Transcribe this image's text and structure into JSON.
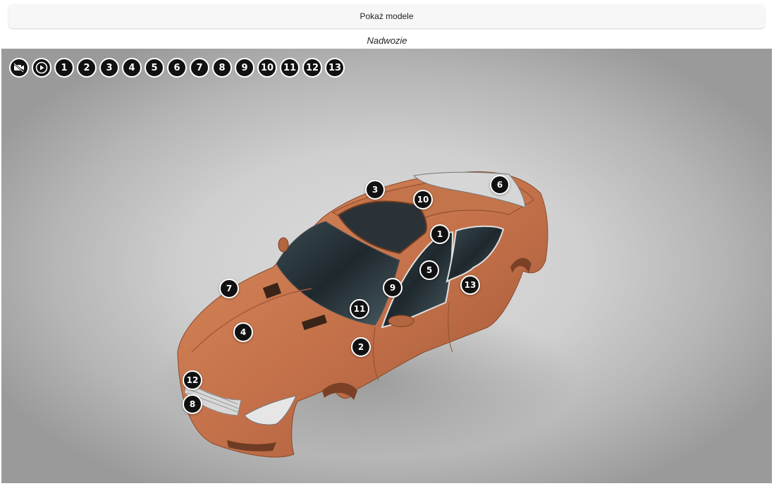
{
  "header": {
    "show_models_label": "Pokaż modele",
    "section_title": "Nadwozie"
  },
  "toolbar": {
    "camera_icon": "camera-off-icon",
    "play_icon": "play-icon",
    "numbers": [
      "1",
      "2",
      "3",
      "4",
      "5",
      "6",
      "7",
      "8",
      "9",
      "10",
      "11",
      "12",
      "13"
    ]
  },
  "hotspots": {
    "h1": "1",
    "h2": "2",
    "h3": "3",
    "h4": "4",
    "h5": "5",
    "h6": "6",
    "h7": "7",
    "h8": "8",
    "h9": "9",
    "h10": "10",
    "h11": "11",
    "h12": "12",
    "h13": "13"
  },
  "colors": {
    "car_body": "#c8764a",
    "hotspot_fill": "#111111",
    "hotspot_border": "#ffffff"
  }
}
